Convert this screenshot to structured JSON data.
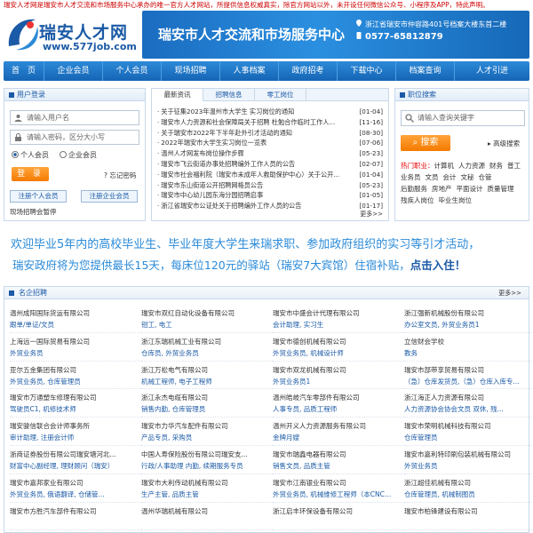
{
  "notice": "瑞安人才网是瑞安市人才交流和市场服务中心承办的唯一官方人才网站，所提供信息权威真实，除官方网站以外，未开设任何微信公众号、小程序及APP，特此声明。",
  "logo": {
    "cn": "瑞安人才网",
    "url": "www.577job.com"
  },
  "banner": {
    "title": "瑞安市人才交流和市场服务中心",
    "address": "浙江省瑞安市仲容路401号档案大楼东首二楼",
    "phone": "0577-65812879"
  },
  "nav": [
    "首　页",
    "企业会员",
    "个人会员",
    "现场招聘",
    "人事档案",
    "政府招考",
    "下载中心",
    "档案查询",
    "人才引进"
  ],
  "login": {
    "title": "用户登录",
    "username_placeholder": "请输入用户名",
    "password_placeholder": "请输入密码，区分大小写",
    "radio_personal": "个人会员",
    "radio_company": "企业会员",
    "login_btn": "登 录",
    "forgot": "忘记密码",
    "reg_personal": "注册个人会员",
    "reg_company": "注册企业会员",
    "pause": "现场招聘会暂停"
  },
  "news": {
    "tabs": [
      "最新资讯",
      "招聘信息",
      "零工岗位"
    ],
    "items": [
      {
        "t": "关于征集2023年温州市大学生 实习岗位的通知",
        "d": "[01-04]"
      },
      {
        "t": "瑞安市人力资源和社会保障局关于招聘 杜勉合作临时工作人...",
        "d": "[11-16]"
      },
      {
        "t": "关于瑞安市2022年下半年赴外引才活动的通知",
        "d": "[08-30]"
      },
      {
        "t": "2022年瑞安市大学生实习岗位一览表",
        "d": "[07-06]"
      },
      {
        "t": "温州人才网发布岗位操作步骤",
        "d": "[05-23]"
      },
      {
        "t": "瑞安市飞云街道办事处招聘编外工作人员的公告",
        "d": "[02-07]"
      },
      {
        "t": "瑞安市社会福利院（瑞安市未成年人救助保护中心）关于公开...",
        "d": "[01-04]"
      },
      {
        "t": "瑞安市东山街道公开招聘网格员公告",
        "d": "[05-23]"
      },
      {
        "t": "瑞安市中心幼儿园东海分园招聘启事",
        "d": "[01-05]"
      },
      {
        "t": "浙江省瑞安市公证处关于招聘编外工作人员的公告",
        "d": "[01-17]"
      }
    ],
    "more": "更多>>"
  },
  "search": {
    "title": "职位搜索",
    "placeholder": "请输入查询关键字",
    "btn": "搜索",
    "adv": "高级搜索",
    "hot_label": "热门职业：",
    "hot": [
      "计算机",
      "人力资源",
      "财务",
      "普工",
      "业务员",
      "文员",
      "会计",
      "文秘",
      "仓管",
      "后勤服务",
      "房地产",
      "平面设计",
      "质量管理",
      "残疾人岗位",
      "毕业生岗位"
    ]
  },
  "promo": {
    "line1": "欢迎毕业5年内的高校毕业生、毕业年度大学生来瑞求职、参加政府组织的实习等引才活动，",
    "line2a": "瑞安政府将为您提供最长15天，每床位120元的驿站（瑞安7大宾馆）住宿补贴，",
    "line2b": "点击入住！"
  },
  "famous": {
    "title": "名企招聘",
    "more": "更多>>",
    "items": [
      {
        "n": "温州成阳国际货运有限公司",
        "j": "跟单/单证/文员"
      },
      {
        "n": "瑞安市双红自动化设备有限公司",
        "j": "钳工, 电工"
      },
      {
        "n": "瑞安市中盛会计代理有限公司",
        "j": "会计助理, 实习生"
      },
      {
        "n": "浙江强新机械股份有限公司",
        "j": "办公室文员, 外贸业务员1"
      },
      {
        "n": "上海远一国际贸易有限公司",
        "j": "外贸业务员"
      },
      {
        "n": "浙江东瑞机械工业有限公司",
        "j": "仓库员, 外贸业务员"
      },
      {
        "n": "瑞安市德创机械有限公司",
        "j": "外贸业务员, 机械设计师"
      },
      {
        "n": "立信财会学校",
        "j": "教务"
      },
      {
        "n": "亚尔五金集团有限公司",
        "j": "外贸业务员, 仓库管理员"
      },
      {
        "n": "浙江万松电气有限公司",
        "j": "机械工程师, 电子工程师"
      },
      {
        "n": "瑞安市双龙机械有限公司",
        "j": "外贸业务员1"
      },
      {
        "n": "瑞安市部带享贸易有限公司",
        "j": "（急）仓库发货员,（急）仓库入库专..."
      },
      {
        "n": "瑞安市万通塑车修理有限公司",
        "j": "驾驶员C1, 机修技术师"
      },
      {
        "n": "浙江永杰电缆有限公司",
        "j": "销售内勤, 仓库管理员"
      },
      {
        "n": "温州皓岐汽车零部件有限公司",
        "j": "人事专员, 品质工程师"
      },
      {
        "n": "浙江海正人力资源有限公司",
        "j": "人力资源协会协会文员 双休, 残..."
      },
      {
        "n": "瑞安骏信联合会计师事务所",
        "j": "审计助理, 注册会计师"
      },
      {
        "n": "瑞安市力华汽车配件有限公司",
        "j": "产品专员, 采购员"
      },
      {
        "n": "温州开义人力资源服务有限公司",
        "j": "金牌月嫂"
      },
      {
        "n": "瑞安市荣明机械科技有限公司",
        "j": "仓库管理员"
      },
      {
        "n": "浙商证券股份有限公司瑞安塘河北...",
        "j": "财富中心副经理, 理财顾问（瑞安）"
      },
      {
        "n": "中国人寿保险股份有限公司瑞安支...",
        "j": "行政/人事助理 内勤, 续期服务专员"
      },
      {
        "n": "瑞安市瑞鑫电器有限公司",
        "j": "销售文员, 品质主管"
      },
      {
        "n": "瑞安市嘉利特印刷包装机械有限公司",
        "j": "外贸业务员"
      },
      {
        "n": "瑞安市嘉邦家业有限公司",
        "j": "外贸业务员, 俄语翻译, 仓储管..."
      },
      {
        "n": "瑞安市大利传动机械有限公司",
        "j": "生产主管, 品质主管"
      },
      {
        "n": "瑞安市江南银业有限公司",
        "j": "外贸业务员, 机械维修工程师（本CNC加工中...）"
      },
      {
        "n": "浙江超佳机械有限公司",
        "j": "仓库管理员, 机械制图员"
      },
      {
        "n": "瑞安市方胜汽车部件有限公司",
        "j": ""
      },
      {
        "n": "温州华瑞机械有限公司",
        "j": ""
      },
      {
        "n": "浙江启丰环保设备有限公司",
        "j": ""
      },
      {
        "n": "瑞安市柏锋建设有限公司",
        "j": ""
      }
    ]
  }
}
